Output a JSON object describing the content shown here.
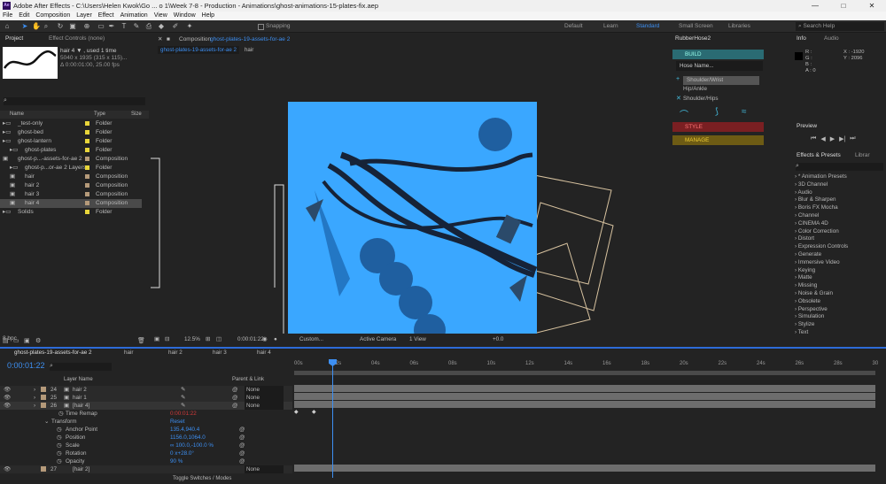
{
  "window": {
    "title": "Adobe After Effects - C:\\Users\\Helen Kwok\\Go ... o 1\\Week 7-8 - Production - Animations\\ghost-animations-15-plates-fix.aep",
    "logo": "Ae",
    "controls": [
      "—",
      "□",
      "✕"
    ]
  },
  "menu": [
    "File",
    "Edit",
    "Composition",
    "Layer",
    "Effect",
    "Animation",
    "View",
    "Window",
    "Help"
  ],
  "toolbar": {
    "snapping": "Snapping",
    "workspaces": [
      "Default",
      "Learn",
      "Standard",
      "Small Screen",
      "Libraries"
    ],
    "active": "Standard",
    "search_placeholder": "Search Help"
  },
  "project": {
    "tab": "Project",
    "effects_tab": "Effect Controls (none)",
    "selected_name": "hair 4 ▼ , used 1 time",
    "selected_info1": "5040 x 1935  (315 x 115)...",
    "selected_info2": "Δ 0:00:01:00, 25.00 fps",
    "cols": {
      "name": "Name",
      "type": "Type",
      "size": "Size"
    },
    "items": [
      {
        "name": "_test-only",
        "type": "Folder",
        "color": "#e8d53a"
      },
      {
        "name": "ghost-bed",
        "type": "Folder",
        "color": "#e8d53a"
      },
      {
        "name": "ghost-lantern",
        "type": "Folder",
        "color": "#e8d53a"
      },
      {
        "name": "ghost-plates",
        "type": "Folder",
        "color": "#e8d53a"
      },
      {
        "name": "ghost-p...-assets-for-ae 2",
        "type": "Composition",
        "color": "#b59a7a"
      },
      {
        "name": "ghost-p...or-ae 2 Layers",
        "type": "Folder",
        "color": "#e8d53a"
      },
      {
        "name": "hair",
        "type": "Composition",
        "color": "#b59a7a"
      },
      {
        "name": "hair 2",
        "type": "Composition",
        "color": "#b59a7a"
      },
      {
        "name": "hair 3",
        "type": "Composition",
        "color": "#b59a7a"
      },
      {
        "name": "hair 4",
        "type": "Composition",
        "color": "#b59a7a"
      },
      {
        "name": "Solids",
        "type": "Folder",
        "color": "#e8d53a"
      }
    ],
    "bpc": "8 bpc"
  },
  "viewer": {
    "tab": "Composition",
    "comp_name": "ghost-plates-19-assets-for-ae 2",
    "breadcrumb": [
      "ghost-plates-19-assets-for-ae 2",
      "hair"
    ],
    "zoom": "12.5%",
    "timecode": "0:00:01:22",
    "quality": "Custom...",
    "camera": "Active Camera",
    "views": "1 View",
    "exposure": "+0.0"
  },
  "rubberhose": {
    "title": "RubberHose2",
    "build": "BUILD",
    "hose_name": "Hose Name...",
    "list": [
      "Shoulder/Wrist",
      "Hip/Ankle",
      "Shoulder/Hips"
    ],
    "style": "STYLE",
    "manage": "MANAGE"
  },
  "info": {
    "tab": "Info",
    "audio_tab": "Audio",
    "r": "R :",
    "g": "G :",
    "b": "B :",
    "a": "A : 0",
    "x": "X : -1920",
    "y": "Y : 2096"
  },
  "preview": {
    "title": "Preview"
  },
  "effects": {
    "tab": "Effects & Presets",
    "lib_tab": "Librar",
    "items": [
      "* Animation Presets",
      "3D Channel",
      "Audio",
      "Blur & Sharpen",
      "Boris FX Mocha",
      "Channel",
      "CINEMA 4D",
      "Color Correction",
      "Distort",
      "Expression Controls",
      "Generate",
      "Immersive Video",
      "Keying",
      "Matte",
      "Missing",
      "Noise & Grain",
      "Obsolete",
      "Perspective",
      "Simulation",
      "Stylize",
      "Text"
    ]
  },
  "timeline": {
    "tabs": [
      "ghost-plates-19-assets-for-ae 2",
      "hair",
      "hair 2",
      "hair 3",
      "hair 4"
    ],
    "timecode": "0:00:01:22",
    "col_layer": "Layer Name",
    "col_parent": "Parent & Link",
    "ticks": [
      "00s",
      "02s",
      "04s",
      "06s",
      "08s",
      "10s",
      "12s",
      "14s",
      "16s",
      "18s",
      "20s",
      "22s",
      "24s",
      "26s",
      "28s",
      "30"
    ],
    "layers": [
      {
        "num": "24",
        "name": "hair 2",
        "parent": "None"
      },
      {
        "num": "25",
        "name": "hair 1",
        "parent": "None"
      },
      {
        "num": "26",
        "name": "[hair 4]",
        "parent": "None"
      }
    ],
    "time_remap": {
      "label": "Time Remap",
      "value": "0:00:01:22"
    },
    "transform": {
      "label": "Transform",
      "reset": "Reset"
    },
    "props": [
      {
        "label": "Anchor Point",
        "value": "135.4,940.4"
      },
      {
        "label": "Position",
        "value": "1156.0,1064.0"
      },
      {
        "label": "Scale",
        "value": "∞ 100.0,-100.0 %"
      },
      {
        "label": "Rotation",
        "value": "0 x+28.0°"
      },
      {
        "label": "Opacity",
        "value": "90 %"
      }
    ],
    "bottom_layer": {
      "num": "27",
      "name": "[hair 2]",
      "parent": "None"
    },
    "toggle": "Toggle Switches / Modes"
  }
}
